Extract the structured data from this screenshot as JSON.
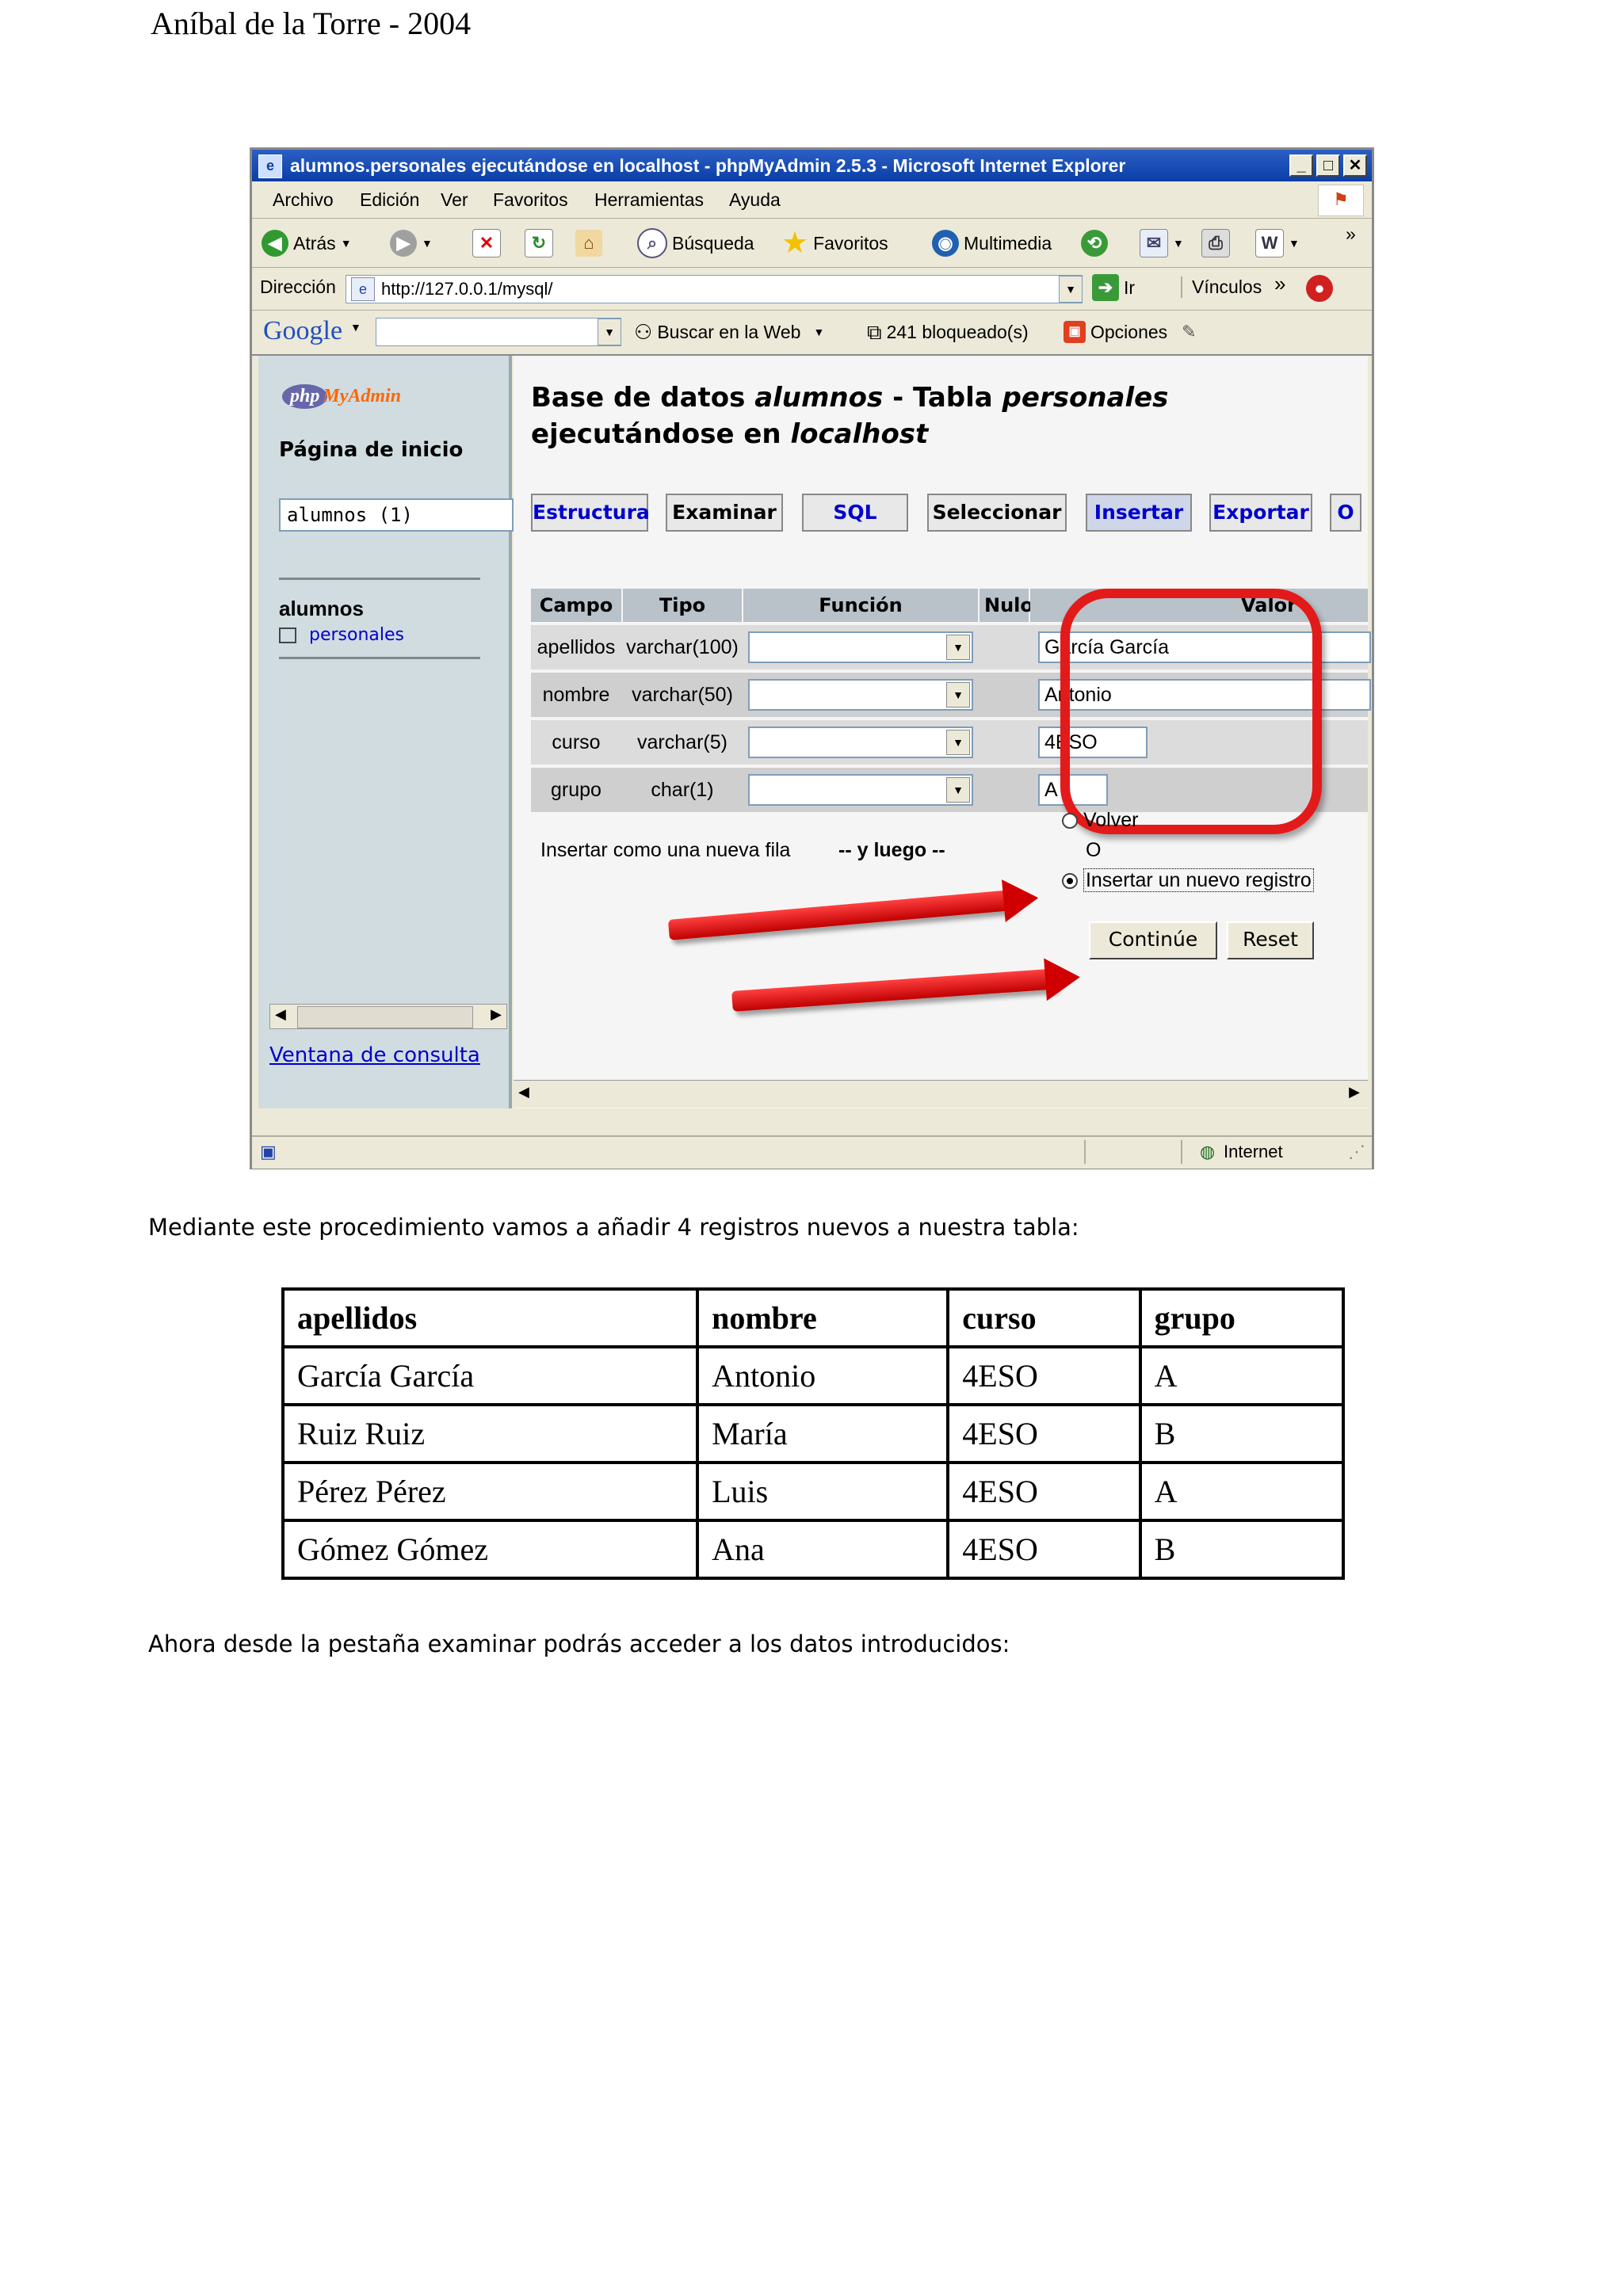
{
  "header": {
    "author": "Aníbal de la Torre - 2004"
  },
  "browser": {
    "title": "alumnos.personales ejecutándose en localhost - phpMyAdmin 2.5.3 - Microsoft Internet Explorer",
    "window_buttons": [
      "_",
      "□",
      "✕"
    ],
    "menu": [
      "Archivo",
      "Edición",
      "Ver",
      "Favoritos",
      "Herramientas",
      "Ayuda"
    ],
    "toolbar": {
      "back": "Atrás",
      "search": "Búsqueda",
      "favorites": "Favoritos",
      "media": "Multimedia"
    },
    "address": {
      "label": "Dirección",
      "url": "http://127.0.0.1/mysql/",
      "go": "Ir",
      "links": "Vínculos"
    },
    "google": {
      "logo": "Google",
      "search_web": "Buscar en la Web",
      "blocked": "241 bloqueado(s)",
      "options": "Opciones"
    },
    "status": {
      "zone": "Internet"
    }
  },
  "pma": {
    "logo_php": "php",
    "logo_my": "MyAdmin",
    "home": "Página de inicio",
    "db_select": "alumnos (1)",
    "db_name": "alumnos",
    "table_name": "personales",
    "query_window": "Ventana de consulta",
    "title_1": "Base de datos ",
    "title_db": "alumnos",
    "title_2": " - Tabla ",
    "title_table": "personales",
    "title_3": " ejecutándose en ",
    "title_host": "localhost",
    "tabs": [
      "Estructura",
      "Examinar",
      "SQL",
      "Seleccionar",
      "Insertar",
      "Exportar",
      "O"
    ],
    "columns": [
      "Campo",
      "Tipo",
      "Función",
      "Nulo",
      "Valor"
    ],
    "rows": [
      {
        "field": "apellidos",
        "type": "varchar(100)",
        "value": "García García"
      },
      {
        "field": "nombre",
        "type": "varchar(50)",
        "value": "Antonio"
      },
      {
        "field": "curso",
        "type": "varchar(5)",
        "value": "4ESO"
      },
      {
        "field": "grupo",
        "type": "char(1)",
        "value": "A"
      }
    ],
    "insert_as": "Insertar como una nueva fila",
    "then": "-- y luego --",
    "opt_back": "Volver",
    "opt_or": "O",
    "opt_new": "Insertar un nuevo registro",
    "continue": "Continúe",
    "reset": "Reset"
  },
  "body": {
    "para1": "Mediante este procedimiento vamos a añadir 4 registros nuevos a nuestra tabla:",
    "table_headers": [
      "apellidos",
      "nombre",
      "curso",
      "grupo"
    ],
    "table_rows": [
      [
        "García García",
        "Antonio",
        "4ESO",
        "A"
      ],
      [
        "Ruiz Ruiz",
        "María",
        "4ESO",
        "B"
      ],
      [
        "Pérez Pérez",
        "Luis",
        "4ESO",
        "A"
      ],
      [
        "Gómez Gómez",
        "Ana",
        "4ESO",
        "B"
      ]
    ],
    "para2": "Ahora desde la pestaña examinar podrás acceder a los datos introducidos:"
  }
}
